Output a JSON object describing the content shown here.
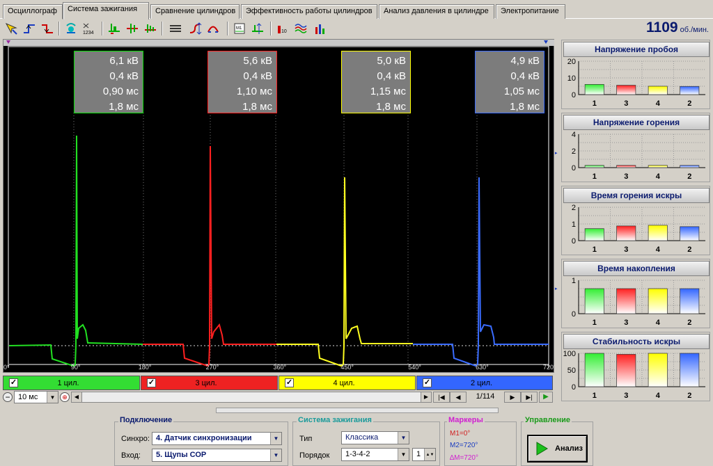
{
  "tabs": [
    "Осциллограф",
    "Система зажигания",
    "Сравнение цилиндров",
    "Эффективность работы цилиндров",
    "Анализ давления в цилиндре",
    "Электропитание"
  ],
  "rpm": {
    "value": "1109",
    "unit": "об./мин."
  },
  "readouts": [
    {
      "kv": "6,1 кВ",
      "burn_kv": "0,4 кВ",
      "burn_ms": "0,90 мс",
      "dwell_ms": "1,8 мс",
      "color": "#00e000"
    },
    {
      "kv": "5,6 кВ",
      "burn_kv": "0,4 кВ",
      "burn_ms": "1,10 мс",
      "dwell_ms": "1,8 мс",
      "color": "#ff2020"
    },
    {
      "kv": "5,0 кВ",
      "burn_kv": "0,4 кВ",
      "burn_ms": "1,15 мс",
      "dwell_ms": "1,8 мс",
      "color": "#ffff00"
    },
    {
      "kv": "4,9 кВ",
      "burn_kv": "0,4 кВ",
      "burn_ms": "1,05 мс",
      "dwell_ms": "1,8 мс",
      "color": "#3a6cff"
    }
  ],
  "axis_labels": [
    "0°",
    "90°",
    "180°",
    "270°",
    "360°",
    "450°",
    "540°",
    "630°",
    "720°"
  ],
  "cylinders": [
    {
      "label": "1 цил.",
      "color": "#33dd33"
    },
    {
      "label": "3 цил.",
      "color": "#ee2222"
    },
    {
      "label": "4 цил.",
      "color": "#ffff00"
    },
    {
      "label": "2 цил.",
      "color": "#3366ff"
    }
  ],
  "timebase": "10 мс",
  "page_counter": "1/114",
  "panels": [
    {
      "title": "Напряжение пробоя",
      "yticks": [
        "20",
        "10",
        "0"
      ],
      "ymax": 20,
      "values": [
        6.1,
        5.6,
        5.0,
        4.9
      ]
    },
    {
      "title": "Напряжение горения",
      "yticks": [
        "4",
        "2",
        "0"
      ],
      "ymax": 6,
      "values": [
        0.4,
        0.4,
        0.4,
        0.4
      ]
    },
    {
      "title": "Время горения искры",
      "yticks": [
        "2",
        "1",
        "0"
      ],
      "ymax": 2.5,
      "values": [
        0.9,
        1.1,
        1.15,
        1.05
      ]
    },
    {
      "title": "Время накопления",
      "yticks": [
        "1",
        "0"
      ],
      "ymax": 2.4,
      "values": [
        1.8,
        1.8,
        1.8,
        1.8
      ]
    },
    {
      "title": "Стабильность искры",
      "yticks": [
        "100",
        "50",
        "0"
      ],
      "ymax": 100,
      "values": [
        100,
        97,
        100,
        100
      ]
    }
  ],
  "bar_labels": [
    "1",
    "3",
    "4",
    "2"
  ],
  "connection": {
    "title": "Подключение",
    "sync_label": "Синхро:",
    "sync_value": "4.  Датчик синхронизации",
    "input_label": "Вход:",
    "input_value": "5.  Щупы СОР"
  },
  "ignition": {
    "title": "Система зажигания",
    "type_label": "Тип",
    "type_value": "Классика",
    "order_label": "Порядок",
    "order_value": "1-3-4-2",
    "order_num": "1"
  },
  "markers": {
    "title": "Маркеры",
    "m1": "M1=0°",
    "m2": "M2=720°",
    "dm": "∆M=720°"
  },
  "control": {
    "title": "Управление",
    "analyze": "Анализ"
  }
}
